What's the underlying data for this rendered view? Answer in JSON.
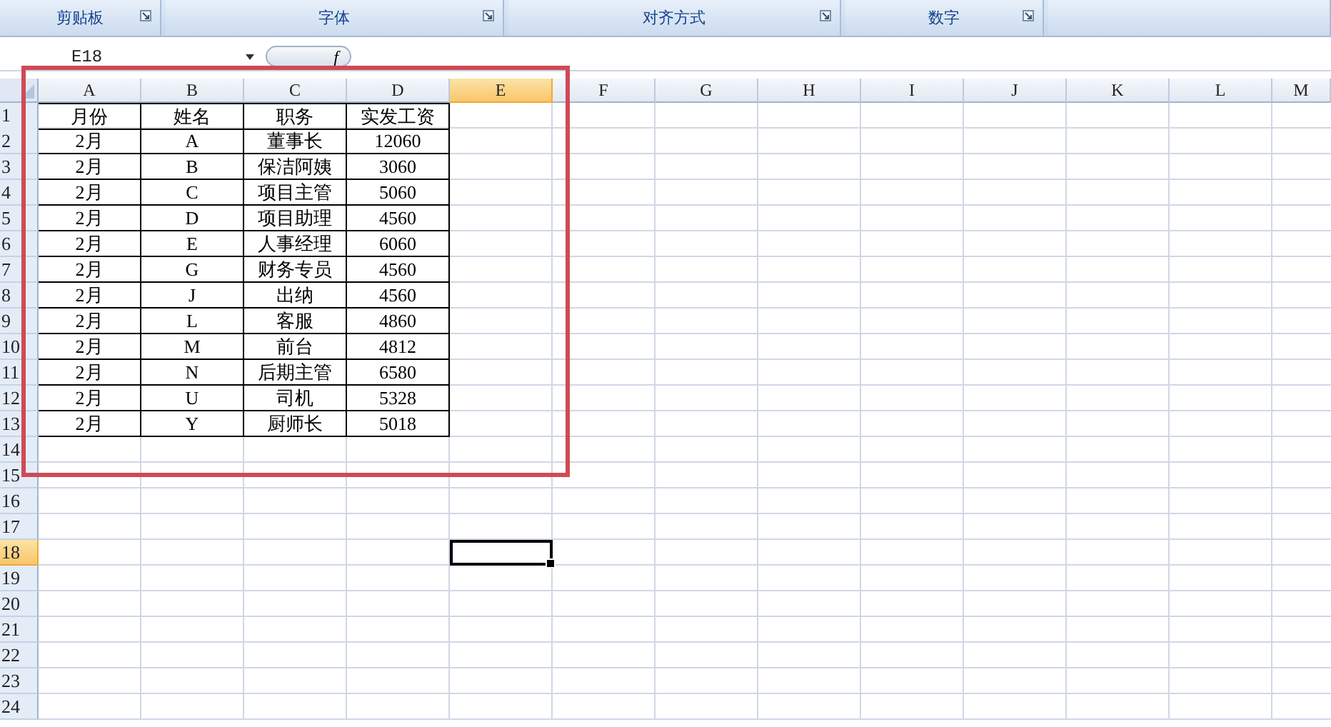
{
  "ribbon_groups": [
    {
      "label": "剪贴板"
    },
    {
      "label": "字体"
    },
    {
      "label": "对齐方式"
    },
    {
      "label": "数字"
    }
  ],
  "name_box": "E18",
  "formula_label": "f",
  "columns": [
    {
      "label": "A",
      "selected": false
    },
    {
      "label": "B",
      "selected": false
    },
    {
      "label": "C",
      "selected": false
    },
    {
      "label": "D",
      "selected": false
    },
    {
      "label": "E",
      "selected": true
    },
    {
      "label": "F",
      "selected": false
    },
    {
      "label": "G",
      "selected": false
    },
    {
      "label": "H",
      "selected": false
    },
    {
      "label": "I",
      "selected": false
    },
    {
      "label": "J",
      "selected": false
    },
    {
      "label": "K",
      "selected": false
    },
    {
      "label": "L",
      "selected": false
    },
    {
      "label": "M",
      "selected": false
    }
  ],
  "rows": [
    {
      "label": "1",
      "selected": false,
      "cells": [
        "月份",
        "姓名",
        "职务",
        "实发工资"
      ]
    },
    {
      "label": "2",
      "selected": false,
      "cells": [
        "2月",
        "A",
        "董事长",
        "12060"
      ]
    },
    {
      "label": "3",
      "selected": false,
      "cells": [
        "2月",
        "B",
        "保洁阿姨",
        "3060"
      ]
    },
    {
      "label": "4",
      "selected": false,
      "cells": [
        "2月",
        "C",
        "项目主管",
        "5060"
      ]
    },
    {
      "label": "5",
      "selected": false,
      "cells": [
        "2月",
        "D",
        "项目助理",
        "4560"
      ]
    },
    {
      "label": "6",
      "selected": false,
      "cells": [
        "2月",
        "E",
        "人事经理",
        "6060"
      ]
    },
    {
      "label": "7",
      "selected": false,
      "cells": [
        "2月",
        "G",
        "财务专员",
        "4560"
      ]
    },
    {
      "label": "8",
      "selected": false,
      "cells": [
        "2月",
        "J",
        "出纳",
        "4560"
      ]
    },
    {
      "label": "9",
      "selected": false,
      "cells": [
        "2月",
        "L",
        "客服",
        "4860"
      ]
    },
    {
      "label": "10",
      "selected": false,
      "cells": [
        "2月",
        "M",
        "前台",
        "4812"
      ]
    },
    {
      "label": "11",
      "selected": false,
      "cells": [
        "2月",
        "N",
        "后期主管",
        "6580"
      ]
    },
    {
      "label": "12",
      "selected": false,
      "cells": [
        "2月",
        "U",
        "司机",
        "5328"
      ]
    },
    {
      "label": "13",
      "selected": false,
      "cells": [
        "2月",
        "Y",
        "厨师长",
        "5018"
      ]
    },
    {
      "label": "14",
      "selected": false,
      "cells": []
    },
    {
      "label": "15",
      "selected": false,
      "cells": []
    },
    {
      "label": "16",
      "selected": false,
      "cells": []
    },
    {
      "label": "17",
      "selected": false,
      "cells": []
    },
    {
      "label": "18",
      "selected": true,
      "cells": []
    },
    {
      "label": "19",
      "selected": false,
      "cells": []
    },
    {
      "label": "20",
      "selected": false,
      "cells": []
    },
    {
      "label": "21",
      "selected": false,
      "cells": []
    },
    {
      "label": "22",
      "selected": false,
      "cells": []
    },
    {
      "label": "23",
      "selected": false,
      "cells": []
    },
    {
      "label": "24",
      "selected": false,
      "cells": []
    }
  ]
}
